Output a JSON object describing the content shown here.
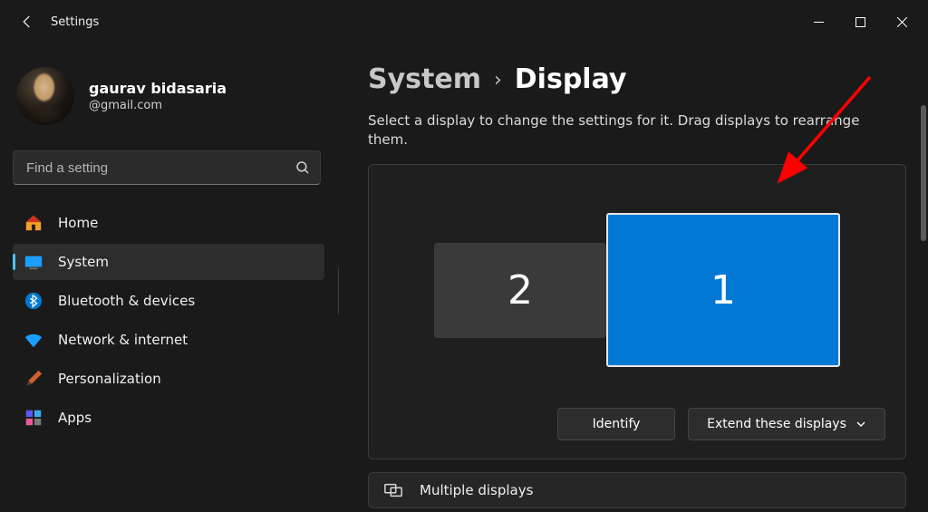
{
  "window": {
    "title": "Settings"
  },
  "profile": {
    "name": "gaurav bidasaria",
    "email": "@gmail.com"
  },
  "search": {
    "placeholder": "Find a setting"
  },
  "sidebar": {
    "items": [
      {
        "label": "Home"
      },
      {
        "label": "System"
      },
      {
        "label": "Bluetooth & devices"
      },
      {
        "label": "Network & internet"
      },
      {
        "label": "Personalization"
      },
      {
        "label": "Apps"
      }
    ]
  },
  "breadcrumb": {
    "parent": "System",
    "current": "Display"
  },
  "instruction": "Select a display to change the settings for it. Drag displays to rearrange them.",
  "displays": {
    "secondary_label": "2",
    "primary_label": "1"
  },
  "actions": {
    "identify": "Identify",
    "extend": "Extend these displays"
  },
  "next_section": {
    "label": "Multiple displays"
  },
  "colors": {
    "accent": "#0078d4"
  }
}
